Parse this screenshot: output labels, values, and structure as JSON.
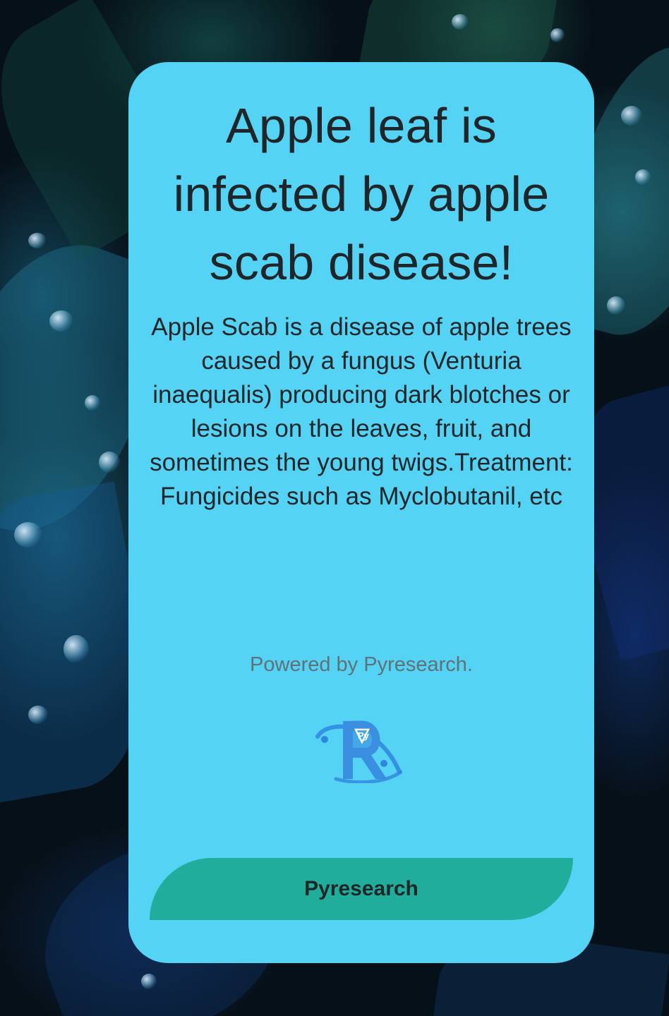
{
  "result": {
    "title": "Apple leaf is infected by apple scab disease!",
    "description": "Apple Scab is a disease of apple trees caused by a fungus (Venturia inaequalis) producing dark blotches or lesions on the leaves, fruit, and sometimes the young twigs.Treatment: Fungicides such as Myclobutanil, etc"
  },
  "footer": {
    "powered_by": "Powered by Pyresearch.",
    "logo_icon": "pyresearch-logo-icon",
    "button_label": "Pyresearch"
  },
  "colors": {
    "card_background": "#55d3f5",
    "button_background": "#20ad9b",
    "text": "#1f2528",
    "muted_text": "#5f7277"
  }
}
